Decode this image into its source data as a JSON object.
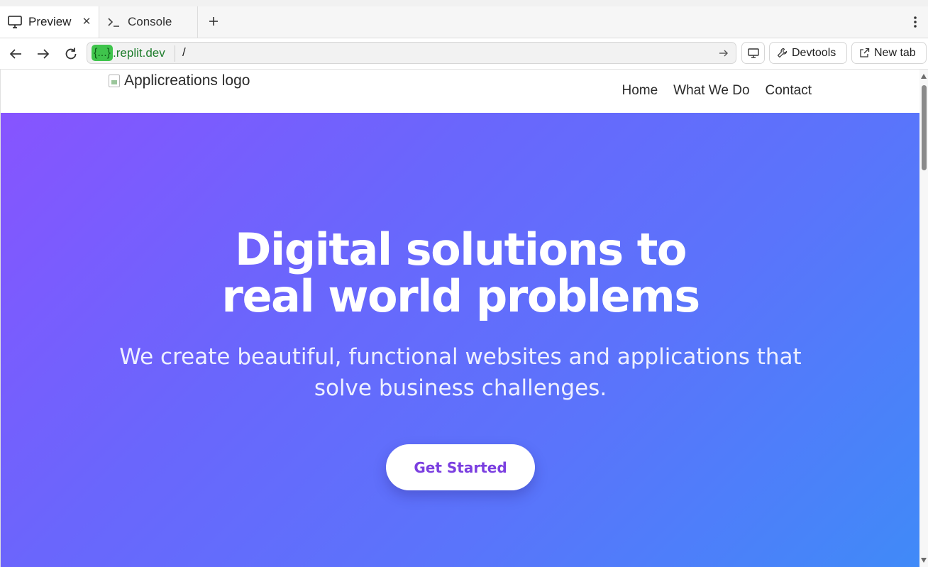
{
  "tabs": [
    {
      "label": "Preview",
      "icon": "monitor-icon",
      "active": true
    },
    {
      "label": "Console",
      "icon": "terminal-icon",
      "active": false
    }
  ],
  "address": {
    "host_pill": "{...}",
    "host": ".replit.dev",
    "path": "/"
  },
  "toolbar": {
    "devtools_label": "Devtools",
    "newtab_label": "New tab"
  },
  "site": {
    "logo_alt": "Applicreations logo",
    "nav": [
      "Home",
      "What We Do",
      "Contact"
    ]
  },
  "hero": {
    "title_line1": "Digital solutions to",
    "title_line2": "real world problems",
    "subtitle_line1": "We create beautiful, functional websites and applications that",
    "subtitle_line2": "solve business challenges.",
    "cta_label": "Get Started"
  },
  "colors": {
    "cta_text": "#7b3fe0",
    "gradient_start": "#8754ff",
    "gradient_end": "#408af8",
    "url_pill": "#3fc44c"
  }
}
